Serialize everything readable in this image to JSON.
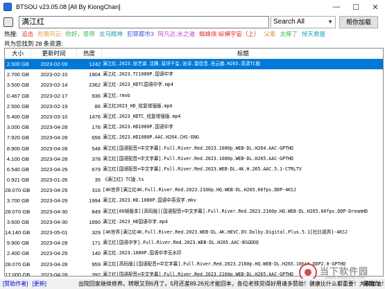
{
  "window": {
    "title": "BTSOU v23.05.08 [All By KiongChan]",
    "minimize": "—",
    "maximize": "☐",
    "close": "✕"
  },
  "search": {
    "value": "满江红",
    "mode": "Search All",
    "help_button": "帮你加载"
  },
  "hot": {
    "label": "热搜:",
    "items": [
      {
        "text": "追击",
        "color": "#e0302b"
      },
      {
        "text": "检察风云",
        "color": "#e6a23c"
      },
      {
        "text": "你好，恩师",
        "color": "#3bb44a"
      },
      {
        "text": "龙马精神",
        "color": "#1aa0b8"
      },
      {
        "text": "犯罪都市3",
        "color": "#3f5bd6"
      },
      {
        "text": "阿凡达:水之道",
        "color": "#c73fc7"
      },
      {
        "text": "蜘蛛侠:纵横宇宙（上）",
        "color": "#e0302b"
      },
      {
        "text": "父辈",
        "color": "#e68a1f"
      },
      {
        "text": "太棒了",
        "color": "#3bb44a"
      },
      {
        "text": "悼天救援",
        "color": "#1aa0b8"
      }
    ]
  },
  "results_count": "共为您找到 28 条资源:",
  "table": {
    "columns": [
      "大小",
      "更新时间",
      "热度",
      "标题"
    ],
    "rows": [
      {
        "size": "2.500 GB",
        "date": "2023-02-09",
        "hot": "1242",
        "title": "满江红.2023.张艺谋.沈腾.易烊千玺.张译.雷佳音.岳云鹏.H265.高清TC版",
        "selected": true
      },
      {
        "size": "2.700 GB",
        "date": "2023-02-10",
        "hot": "1904",
        "title": "满江红.2023.TC1080P.国语中字"
      },
      {
        "size": "3.500 GB",
        "date": "2023-02-14",
        "hot": "2362",
        "title": "满江红-2023_HDTC国语中字.mp4"
      },
      {
        "size": "0.467 GB",
        "date": "2023-02-17",
        "hot": "936",
        "title": "满江红.rmvb"
      },
      {
        "size": "2.500 GB",
        "date": "2023-02-19",
        "hot": "86",
        "title": "满江红2023_HD_绘复增强版.mp4"
      },
      {
        "size": "5.400 GB",
        "date": "2023-03-10",
        "hot": "1476",
        "title": "满江红.2023_HDTC_绘复增强版.mp4"
      },
      {
        "size": "3.000 GB",
        "date": "2023-04-28",
        "hot": "176",
        "title": "满江红.2023.HD1080P.国语中字"
      },
      {
        "size": "7.920 GB",
        "date": "2023-04-28",
        "hot": "656",
        "title": "满江红.2023.HD1080P.AAC.H264.CHS-ENG"
      },
      {
        "size": "8.900 GB",
        "date": "2023-04-28",
        "hot": "548",
        "title": "满江红[国语配音+中文字幕].Full.River.Red.2023.1080p.WEB-DL.H264.AAC-GPTHD"
      },
      {
        "size": "4.100 GB",
        "date": "2023-04-28",
        "hot": "378",
        "title": "满江红[国语配音+中文字幕].Full.River.Red.2023.1080p.WEB-DL.H265.AAC-GPTHD"
      },
      {
        "size": "6.540 GB",
        "date": "2023-04-29",
        "hot": "679",
        "title": "满江红[国语配音+中文字幕].Full.River.Red.2023.WEB-DL.4K.H.265.AAC.5.1-CTRLTV"
      },
      {
        "size": "0.921 GB",
        "date": "2023-01-26",
        "hot": "35",
        "title": "《满江红》TC版.ts"
      },
      {
        "size": "28.070 GB",
        "date": "2023-04-29",
        "hot": "316",
        "title": "[4K世界]满江红4K.Full.River.Red.2023.2160p.HQ.WEB-DL.H265.60fps.DDP-4KSJ"
      },
      {
        "size": "3.700 GB",
        "date": "2023-04-29",
        "hot": "1994",
        "title": "满江红.2023.HD.1080P.国语中英双字.mkv"
      },
      {
        "size": "28.070 GB",
        "date": "2023-04-30",
        "hot": "849",
        "title": "满江红[60帧版本][高码版][国语配音+中文字幕].Full.River.Red.2023.2160p.HQ.WEB-DL.H265.60fps.DDP-DreamHD"
      },
      {
        "size": "3.600 GB",
        "date": "2023-04-30",
        "hot": "1890",
        "title": "满江红-2023_HD国语中字.mp4"
      },
      {
        "size": "14.140 GB",
        "date": "2023-05-01",
        "hot": "329",
        "title": "[4K世界]满江红4K.Full.River.Red.2023.WEB-DL.4K.HEVC.DV.Dolby.Digital.Plus.5.1[杜比视界]-4KSJ"
      },
      {
        "size": "9.900 GB",
        "date": "2023-04-28",
        "hot": "171",
        "title": "满江红[国语中字].Full.River.Red.2023.WEB-DL.H265.AAC-BSGDDQ"
      },
      {
        "size": "2.400 GB",
        "date": "2023-04-29",
        "hot": "140",
        "title": "满江红.2023.1080P.国语中字无水印"
      },
      {
        "size": "28.070 GB",
        "date": "2023-04-28",
        "hot": "959",
        "title": "满江红[高码版][国语配音+中文字幕].Full.River.Red.2023.2160p.HQ.WEB-DL.H265.10bit.DDP2.0-GPTHD"
      },
      {
        "size": "17.000 GB",
        "date": "2023-04-28",
        "hot": "392",
        "title": "满江红[国语配音+中文字幕].Full.River.Red.2023.2160p.WEB-DL.H265.AAC-GPTHD"
      }
    ]
  },
  "status": {
    "author_link": "[赞助作者]",
    "update_link": "[更新]",
    "message": "出院回家继续修养。转眼又到6月了。5月还差89.26元才能回本，各位老铁觉得好用请多赞助！健康比什么都重要！大家加油！",
    "day": "星期六"
  },
  "watermark": {
    "text": "当下软件园",
    "url": "www.downxia.com"
  }
}
